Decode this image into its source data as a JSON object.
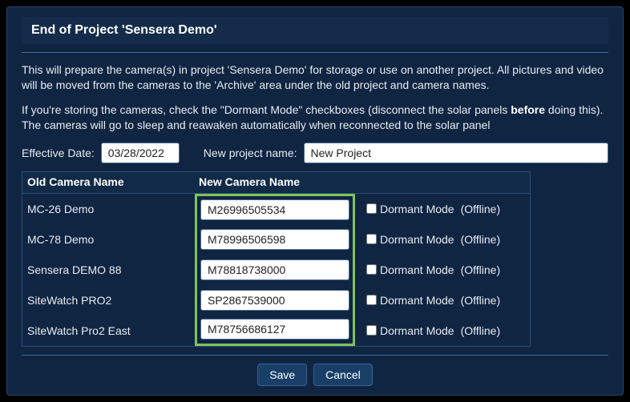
{
  "title": "End of Project 'Sensera Demo'",
  "paragraph1": "This will prepare the camera(s) in project 'Sensera Demo' for storage or use on another project. All pictures and video will be moved from the cameras to the 'Archive' area under the old project and camera names.",
  "paragraph2_a": "If you're storing the cameras, check the \"Dormant Mode\" checkboxes (disconnect the solar panels ",
  "paragraph2_bold": "before",
  "paragraph2_b": " doing this). The cameras will go to sleep and reawaken automatically when reconnected to the solar panel",
  "effective_date_label": "Effective Date:",
  "effective_date_value": "03/28/2022",
  "new_project_label": "New project name:",
  "new_project_value": "New Project",
  "table": {
    "head_old": "Old Camera Name",
    "head_new": "New Camera Name",
    "dormant_label": "Dormant Mode",
    "rows": [
      {
        "old": "MC-26 Demo",
        "new": "M26996505534",
        "status": "(Offline)"
      },
      {
        "old": "MC-78 Demo",
        "new": "M78996506598",
        "status": "(Offline)"
      },
      {
        "old": "Sensera DEMO 88",
        "new": "M78818738000",
        "status": "(Offline)"
      },
      {
        "old": "SiteWatch PRO2",
        "new": "SP2867539000",
        "status": "(Offline)"
      },
      {
        "old": "SiteWatch Pro2 East",
        "new": "M78756686127",
        "status": "(Offline)"
      }
    ]
  },
  "buttons": {
    "save": "Save",
    "cancel": "Cancel"
  }
}
